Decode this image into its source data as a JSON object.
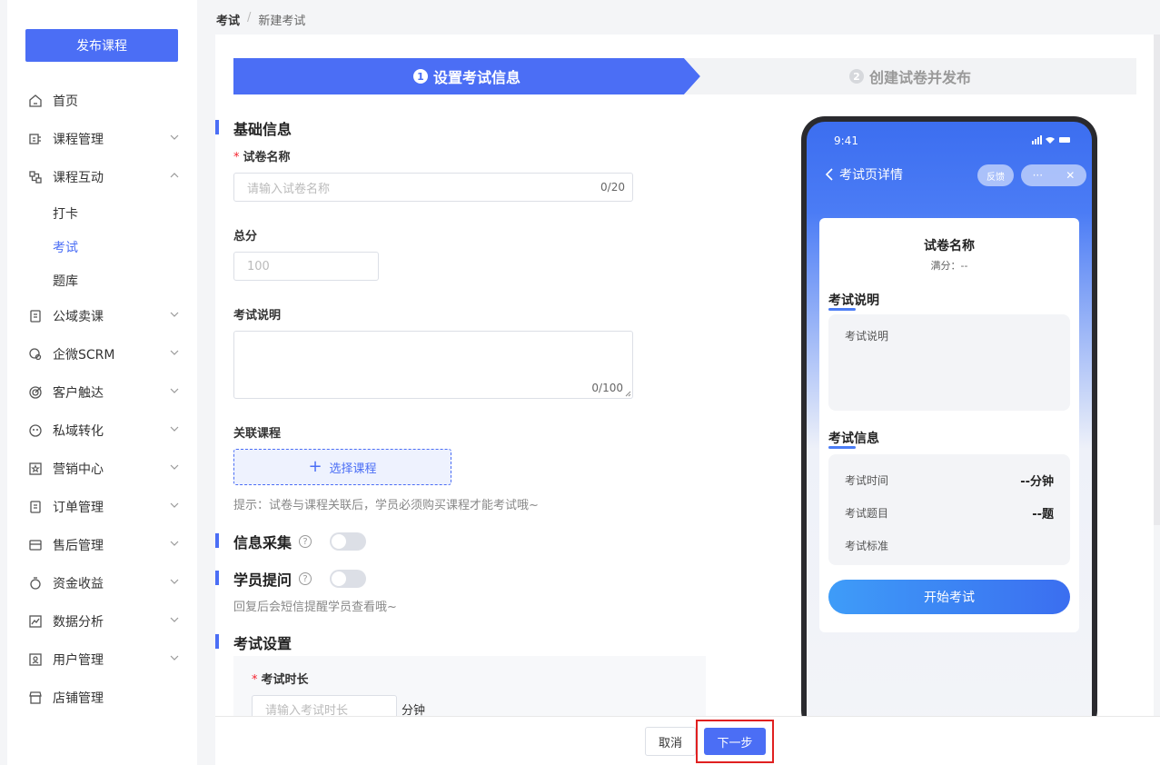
{
  "sidebar": {
    "publish_label": "发布课程",
    "items": [
      {
        "label": "首页",
        "icon": "home-icon"
      },
      {
        "label": "课程管理",
        "icon": "course-icon"
      },
      {
        "label": "课程互动",
        "icon": "interact-icon"
      },
      {
        "label": "公域卖课",
        "icon": "public-icon"
      },
      {
        "label": "企微SCRM",
        "icon": "scrm-icon"
      },
      {
        "label": "客户触达",
        "icon": "reach-icon"
      },
      {
        "label": "私域转化",
        "icon": "private-icon"
      },
      {
        "label": "营销中心",
        "icon": "marketing-icon"
      },
      {
        "label": "订单管理",
        "icon": "order-icon"
      },
      {
        "label": "售后管理",
        "icon": "aftersale-icon"
      },
      {
        "label": "资金收益",
        "icon": "money-icon"
      },
      {
        "label": "数据分析",
        "icon": "chart-icon"
      },
      {
        "label": "用户管理",
        "icon": "user-icon"
      },
      {
        "label": "店铺管理",
        "icon": "shop-icon"
      }
    ],
    "sub_items": [
      "打卡",
      "考试",
      "题库"
    ]
  },
  "breadcrumb": {
    "level1": "考试",
    "separator": "/",
    "level2": "新建考试"
  },
  "steps": {
    "step1_num": "1",
    "step1": "设置考试信息",
    "step2_num": "2",
    "step2": "创建试卷并发布"
  },
  "form": {
    "section_basic": "基础信息",
    "name_label": "试卷名称",
    "name_placeholder": "请输入试卷名称",
    "name_count": "0/20",
    "score_label": "总分",
    "score_placeholder": "100",
    "desc_label": "考试说明",
    "desc_count": "0/100",
    "course_label": "关联课程",
    "course_button": "选择课程",
    "course_hint": "提示：试卷与课程关联后，学员必须购买课程才能考试哦~",
    "info_collect": "信息采集",
    "student_question": "学员提问",
    "question_hint": "回复后会短信提醒学员查看哦~",
    "section_setting": "考试设置",
    "duration_label": "考试时长",
    "duration_placeholder": "请输入考试时长",
    "duration_unit": "分钟"
  },
  "phone": {
    "time": "9:41",
    "title": "考试页详情",
    "feedback": "反馈",
    "more": "···",
    "close": "✕",
    "paper_name": "试卷名称",
    "full_score": "满分：--",
    "desc_heading": "考试说明",
    "desc_text": "考试说明",
    "info_heading": "考试信息",
    "time_label": "考试时间",
    "time_value": "--分钟",
    "question_label": "考试题目",
    "question_value": "--题",
    "standard_label": "考试标准",
    "start_button": "开始考试"
  },
  "footer": {
    "cancel": "取消",
    "next": "下一步"
  },
  "colors": {
    "accent": "#4b6ef5",
    "highlight": "#e02020"
  }
}
